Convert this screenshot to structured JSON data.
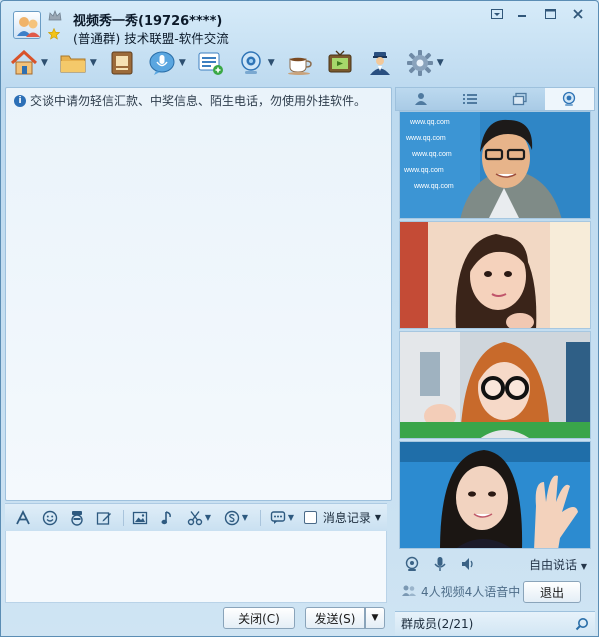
{
  "header": {
    "group_name": "视频秀一秀(19726****)",
    "group_desc": "(普通群) 技术联盟-软件交流"
  },
  "window_buttons": [
    {
      "name": "skin-icon"
    },
    {
      "name": "minimize-icon"
    },
    {
      "name": "maximize-icon"
    },
    {
      "name": "close-icon"
    }
  ],
  "toolbar": {
    "items": [
      {
        "name": "home-icon",
        "has_dropdown": true
      },
      {
        "name": "folder-icon",
        "has_dropdown": true
      },
      {
        "name": "album-icon",
        "has_dropdown": false
      },
      {
        "name": "voice-icon",
        "has_dropdown": true
      },
      {
        "name": "announcement-icon",
        "has_dropdown": false
      },
      {
        "name": "webcam-icon",
        "has_dropdown": true
      },
      {
        "name": "coffee-icon",
        "has_dropdown": false
      },
      {
        "name": "tv-icon",
        "has_dropdown": false
      },
      {
        "name": "admin-icon",
        "has_dropdown": false
      },
      {
        "name": "settings-gear-icon",
        "has_dropdown": true
      }
    ]
  },
  "chat": {
    "notice": "交谈中请勿轻信汇款、中奖信息、陌生电话，勿使用外挂软件。"
  },
  "format_bar": {
    "history_label": "消息记录"
  },
  "buttons": {
    "close": "关闭(C)",
    "send": "发送(S)"
  },
  "video_panel": {
    "speak_mode": "自由说话",
    "status": "4人视频4人语音中",
    "exit_label": "退出",
    "watermark_text": "www.qq.com"
  },
  "members": {
    "label": "群成员(2/21)"
  },
  "colors": {
    "accent": "#2c6fb6",
    "window_bg": "#cfe4f3",
    "border": "#5b8db4"
  }
}
